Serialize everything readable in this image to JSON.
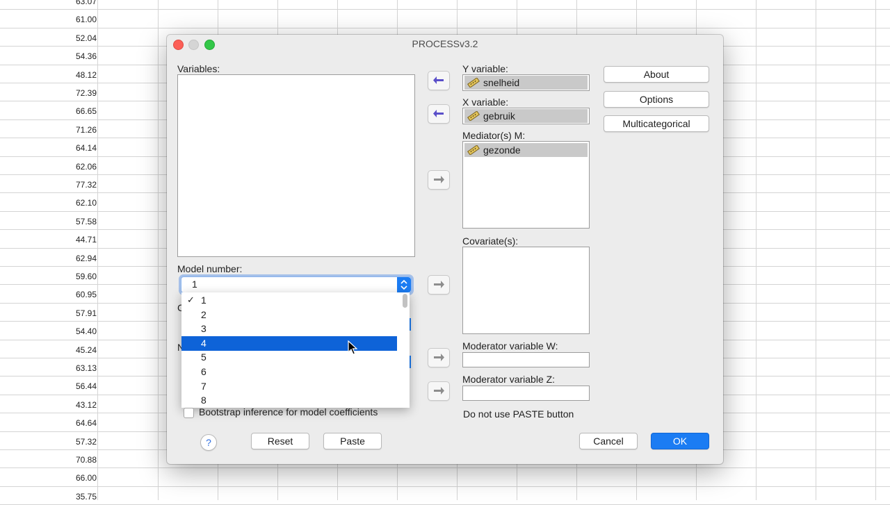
{
  "spreadsheet": {
    "values": [
      "63.07",
      "61.00",
      "52.04",
      "54.36",
      "48.12",
      "72.39",
      "66.65",
      "71.26",
      "64.14",
      "62.06",
      "77.32",
      "62.10",
      "57.58",
      "44.71",
      "62.94",
      "59.60",
      "60.95",
      "57.91",
      "54.40",
      "45.24",
      "63.13",
      "56.44",
      "43.12",
      "64.64",
      "57.32",
      "70.88",
      "66.00",
      "35.75"
    ]
  },
  "dialog": {
    "title": "PROCESSv3.2",
    "variables_label": "Variables:",
    "y_label": "Y variable:",
    "y_value": "snelheid",
    "x_label": "X variable:",
    "x_value": "gebruik",
    "mediator_label": "Mediator(s) M:",
    "mediator_value": "gezonde",
    "covariates_label": "Covariate(s):",
    "moderator_w_label": "Moderator variable W:",
    "moderator_z_label": "Moderator variable Z:",
    "paste_note": "Do not use PASTE button",
    "model_number_label": "Model number:",
    "model_number_value": "1",
    "model_options": [
      "1",
      "2",
      "3",
      "4",
      "5",
      "6",
      "7",
      "8"
    ],
    "selected_option": "4",
    "checked_option": "1",
    "bootstrap_label": "Bootstrap inference for model coefficients",
    "bootstrap_checked": false,
    "partial_labels": [
      "C",
      "N"
    ],
    "buttons": {
      "about": "About",
      "options": "Options",
      "multicategorical": "Multicategorical",
      "reset": "Reset",
      "paste": "Paste",
      "cancel": "Cancel",
      "ok": "OK",
      "help": "?"
    }
  },
  "colors": {
    "accent": "#1b7cf3",
    "selection": "#0e63d8",
    "arrow_active": "#5a4fc9"
  }
}
